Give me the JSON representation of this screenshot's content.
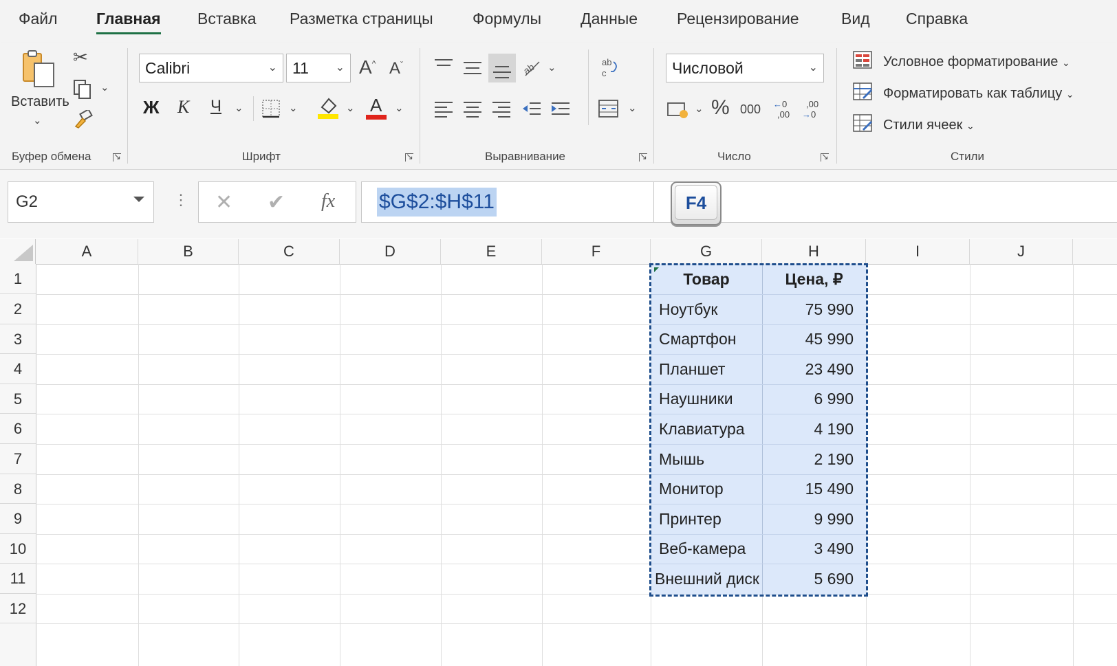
{
  "menu": {
    "tabs": [
      "Файл",
      "Главная",
      "Вставка",
      "Разметка страницы",
      "Формулы",
      "Данные",
      "Рецензирование",
      "Вид",
      "Справка"
    ],
    "active": "Главная"
  },
  "ribbon": {
    "clipboard": {
      "paste_label": "Вставить",
      "group_label": "Буфер обмена"
    },
    "font": {
      "font_name": "Calibri",
      "font_size": "11",
      "bold": "Ж",
      "italic": "К",
      "underline": "Ч",
      "grow": "A",
      "shrink": "A",
      "font_color_glyph": "A",
      "group_label": "Шрифт"
    },
    "alignment": {
      "group_label": "Выравнивание"
    },
    "number": {
      "format": "Числовой",
      "percent": "%",
      "thousands": "000",
      "inc_decimal": "←0 ,00",
      "dec_decimal": ",00 →0",
      "group_label": "Число"
    },
    "styles": {
      "conditional": "Условное форматирование",
      "format_table": "Форматировать как таблицу",
      "cell_styles": "Стили ячеек",
      "group_label": "Стили"
    }
  },
  "formula_bar": {
    "name_box": "G2",
    "fx": "fx",
    "formula": "$G$2:$H$11",
    "key_badge": "F4"
  },
  "sheet": {
    "columns": [
      "A",
      "B",
      "C",
      "D",
      "E",
      "F",
      "G",
      "H",
      "I",
      "J"
    ],
    "rows": [
      "1",
      "2",
      "3",
      "4",
      "5",
      "6",
      "7",
      "8",
      "9",
      "10",
      "11",
      "12"
    ],
    "header": {
      "product": "Товар",
      "price": "Цена, ₽"
    },
    "items": [
      {
        "product": "Ноутбук",
        "price": "75 990"
      },
      {
        "product": "Смартфон",
        "price": "45 990"
      },
      {
        "product": "Планшет",
        "price": "23 490"
      },
      {
        "product": "Наушники",
        "price": "6 990"
      },
      {
        "product": "Клавиатура",
        "price": "4 190"
      },
      {
        "product": "Мышь",
        "price": "2 190"
      },
      {
        "product": "Монитор",
        "price": "15 490"
      },
      {
        "product": "Принтер",
        "price": "9 990"
      },
      {
        "product": "Веб-камера",
        "price": "3 490"
      },
      {
        "product": "Внешний диск",
        "price": "5 690"
      }
    ]
  },
  "colors": {
    "accent": "#1e7145",
    "selection": "#dce8fa",
    "marching_ants": "#1f4e8c",
    "highlight_yellow": "#ffe600",
    "font_red": "#e0241b"
  }
}
